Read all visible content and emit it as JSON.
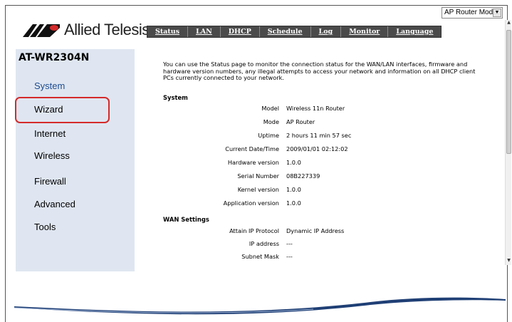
{
  "brand": {
    "name": "Allied Telesis",
    "model": "AT-WR2304N",
    "accent": "#1f4c8f",
    "sidebar_bg": "#dfe6f1",
    "tab_bg": "#4a4a4a",
    "highlight": "#d42a2a"
  },
  "mode_select": {
    "value": "AP Router Mode"
  },
  "tabs": [
    {
      "label": "Status"
    },
    {
      "label": "LAN"
    },
    {
      "label": "DHCP"
    },
    {
      "label": "Schedule"
    },
    {
      "label": "Log"
    },
    {
      "label": "Monitor"
    },
    {
      "label": "Language"
    }
  ],
  "sidebar": {
    "items": [
      {
        "label": "System"
      },
      {
        "label": "Wizard"
      },
      {
        "label": "Internet"
      },
      {
        "label": "Wireless"
      },
      {
        "label": "Firewall"
      },
      {
        "label": "Advanced"
      },
      {
        "label": "Tools"
      }
    ]
  },
  "content": {
    "intro": "You can use the Status page to monitor the connection status for the WAN/LAN interfaces, firmware and hardware version numbers, any illegal attempts to access your network and information on all DHCP client PCs currently connected to your network.",
    "system_title": "System",
    "system_rows": [
      {
        "label": "Model",
        "value": "Wireless 11n Router"
      },
      {
        "label": "Mode",
        "value": "AP Router"
      },
      {
        "label": "Uptime",
        "value": "2 hours 11 min 57 sec"
      },
      {
        "label": "Current Date/Time",
        "value": "2009/01/01 02:12:02"
      },
      {
        "label": "Hardware version",
        "value": "1.0.0"
      },
      {
        "label": "Serial Number",
        "value": "08B227339"
      },
      {
        "label": "Kernel version",
        "value": "1.0.0"
      },
      {
        "label": "Application version",
        "value": "1.0.0"
      }
    ],
    "wan_title": "WAN Settings",
    "wan_rows": [
      {
        "label": "Attain IP Protocol",
        "value": "Dynamic IP Address"
      },
      {
        "label": "IP address",
        "value": "---"
      },
      {
        "label": "Subnet Mask",
        "value": "---"
      }
    ]
  }
}
